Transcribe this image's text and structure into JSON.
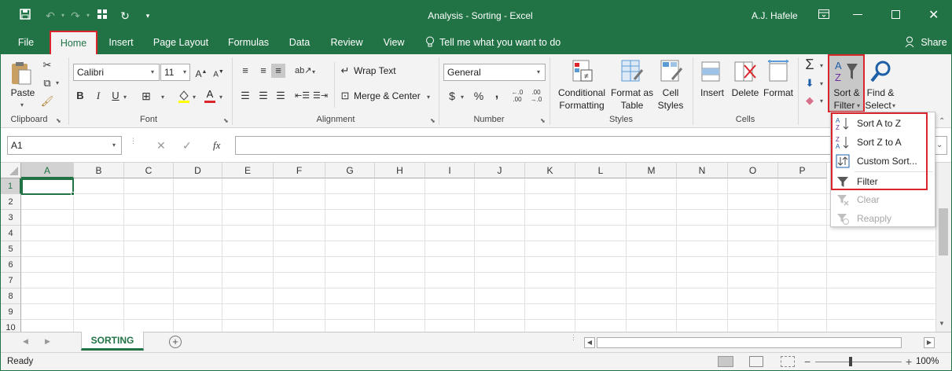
{
  "window": {
    "title": "Analysis - Sorting  -  Excel",
    "user": "A.J. Hafele"
  },
  "tabs": [
    "File",
    "Home",
    "Insert",
    "Page Layout",
    "Formulas",
    "Data",
    "Review",
    "View"
  ],
  "tell_me": "Tell me what you want to do",
  "share": "Share",
  "clipboard": {
    "paste": "Paste",
    "group": "Clipboard"
  },
  "font": {
    "name": "Calibri",
    "size": "11",
    "group": "Font",
    "bold": "B",
    "italic": "I",
    "underline": "U"
  },
  "alignment": {
    "wrap": "Wrap Text",
    "merge": "Merge & Center",
    "group": "Alignment"
  },
  "number": {
    "format": "General",
    "currency": "$",
    "percent": "%",
    "comma": ",",
    "group": "Number"
  },
  "styles": {
    "conditional": [
      "Conditional",
      "Formatting"
    ],
    "format_table": [
      "Format as",
      "Table"
    ],
    "cell_styles": [
      "Cell",
      "Styles"
    ],
    "group": "Styles"
  },
  "cells": {
    "insert": "Insert",
    "delete": "Delete",
    "format": "Format",
    "group": "Cells"
  },
  "editing": {
    "sort_filter": [
      "Sort &",
      "Filter"
    ],
    "find_select": [
      "Find &",
      "Select"
    ]
  },
  "formula_bar": {
    "name_box": "A1",
    "fx": "fx",
    "value": ""
  },
  "columns": [
    "A",
    "B",
    "C",
    "D",
    "E",
    "F",
    "G",
    "H",
    "I",
    "J",
    "K",
    "L",
    "M",
    "N",
    "O",
    "P"
  ],
  "rows": [
    "1",
    "2",
    "3",
    "4",
    "5",
    "6",
    "7",
    "8",
    "9",
    "10"
  ],
  "sheet_tab": "SORTING",
  "status": {
    "ready": "Ready",
    "zoom": "100%"
  },
  "sort_menu": {
    "items": [
      {
        "label": "Sort A to Z",
        "icon": "sort-ascending-icon",
        "enabled": true
      },
      {
        "label": "Sort Z to A",
        "icon": "sort-descending-icon",
        "enabled": true
      },
      {
        "label": "Custom Sort...",
        "icon": "custom-sort-icon",
        "enabled": true
      },
      {
        "label": "Filter",
        "icon": "filter-icon",
        "enabled": true
      },
      {
        "label": "Clear",
        "icon": "clear-filter-icon",
        "enabled": false
      },
      {
        "label": "Reapply",
        "icon": "reapply-icon",
        "enabled": false
      }
    ]
  },
  "colors": {
    "accent": "#217346",
    "highlight": "#d9252b",
    "ribbon": "#f3f3f3"
  }
}
